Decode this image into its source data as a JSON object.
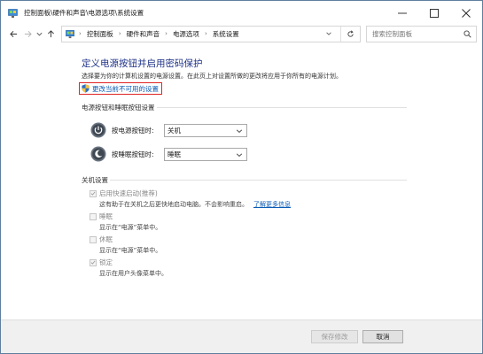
{
  "window": {
    "title": "控制面板\\硬件和声音\\电源选项\\系统设置"
  },
  "navigation": {
    "breadcrumbs": [
      "控制面板",
      "硬件和声音",
      "电源选项",
      "系统设置"
    ],
    "search_placeholder": "搜索控制面板"
  },
  "main": {
    "heading": "定义电源按钮并启用密码保护",
    "description": "选择要为你的计算机设置的电源设置。在此页上对设置所做的更改将应用于你所有的电源计划。",
    "unlock_link": "更改当前不可用的设置",
    "power_section": {
      "title": "电源按钮和睡眠按钮设置",
      "rows": [
        {
          "label": "按电源按钮时:",
          "value": "关机"
        },
        {
          "label": "按睡眠按钮时:",
          "value": "睡眠"
        }
      ]
    },
    "shutdown_section": {
      "title": "关机设置",
      "options": [
        {
          "label": "启用快速启动(推荐)",
          "description": "这有助于在关机之后更快地启动电脑。不会影响重启。",
          "link": "了解更多信息",
          "checked": true
        },
        {
          "label": "睡眠",
          "description": "显示在“电源”菜单中。",
          "checked": false
        },
        {
          "label": "休眠",
          "description": "显示在“电源”菜单中。",
          "checked": false
        },
        {
          "label": "锁定",
          "description": "显示在用户头像菜单中。",
          "checked": true
        }
      ]
    }
  },
  "footer": {
    "save_label": "保存修改",
    "cancel_label": "取消"
  },
  "colors": {
    "heading": "#1e3287",
    "link": "#0b5bb5",
    "highlight_border": "#e02424"
  }
}
